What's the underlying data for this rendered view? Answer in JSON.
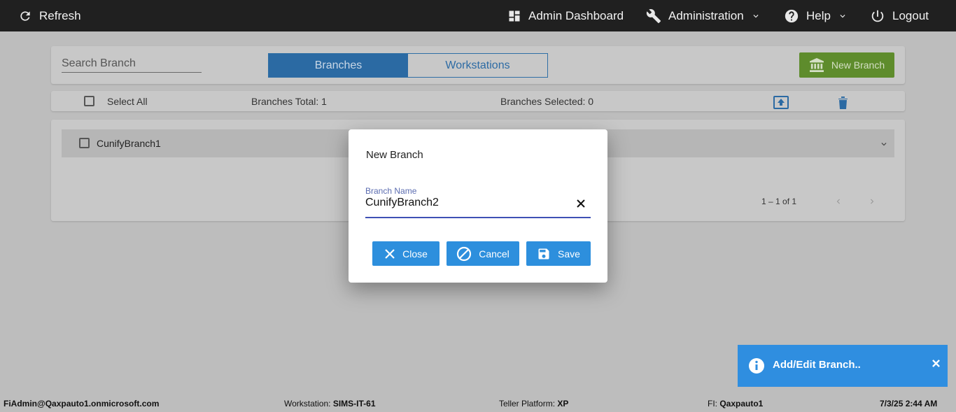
{
  "topbar": {
    "refresh": "Refresh",
    "admin_dashboard": "Admin Dashboard",
    "administration": "Administration",
    "help": "Help",
    "logout": "Logout"
  },
  "toolbar": {
    "search_placeholder": "Search Branch",
    "tabs": [
      "Branches",
      "Workstations"
    ],
    "active_tab": "Branches",
    "new_branch": "New Branch"
  },
  "summary": {
    "select_all": "Select All",
    "total": "Branches Total: 1",
    "selected": "Branches Selected: 0"
  },
  "branches": [
    {
      "name": "CunifyBranch1"
    }
  ],
  "pager": {
    "range": "1 – 1 of 1"
  },
  "dialog": {
    "title": "New Branch",
    "field_label": "Branch Name",
    "field_value": "CunifyBranch2",
    "close": "Close",
    "cancel": "Cancel",
    "save": "Save"
  },
  "toast": {
    "message": "Add/Edit Branch.."
  },
  "status": {
    "user": "FiAdmin@Qaxpauto1.onmicrosoft.com",
    "workstation_label": "Workstation:",
    "workstation": "SIMS-IT-61",
    "platform_label": "Teller Platform:",
    "platform": "XP",
    "fi_label": "FI:",
    "fi": "Qaxpauto1",
    "datetime": "7/3/25 2:44 AM"
  },
  "colors": {
    "topbar": "#202020",
    "primary_button": "#2d8fdd",
    "new_branch_button": "#5e8c2c",
    "toast": "#2f8ee0",
    "field_underline": "#3f51b5"
  }
}
